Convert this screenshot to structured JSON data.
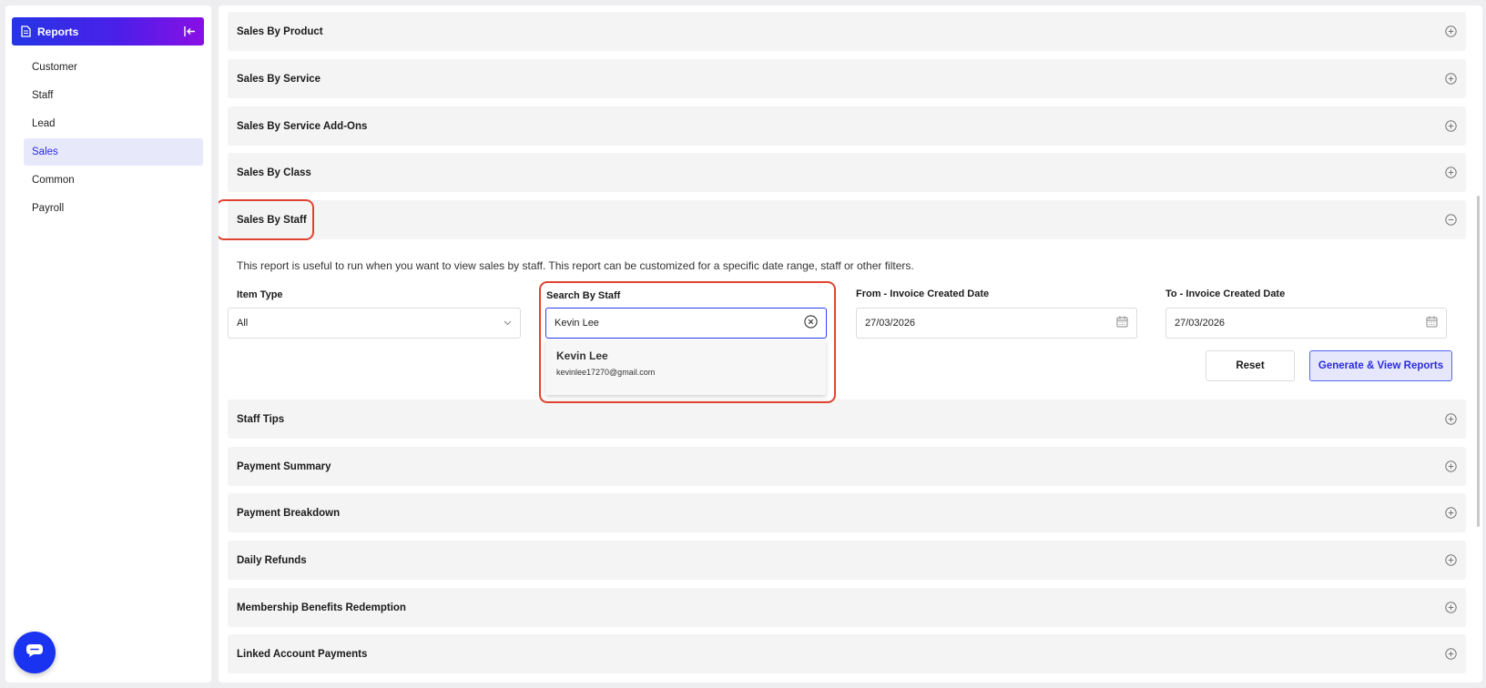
{
  "sidebar": {
    "header_title": "Reports",
    "items": [
      {
        "label": "Customer"
      },
      {
        "label": "Staff"
      },
      {
        "label": "Lead"
      },
      {
        "label": "Sales"
      },
      {
        "label": "Common"
      },
      {
        "label": "Payroll"
      }
    ],
    "active_item": "Sales"
  },
  "accordion": {
    "sales_by_product": "Sales By Product",
    "sales_by_service": "Sales By Service",
    "sales_by_service_addons": "Sales By Service Add-Ons",
    "sales_by_class": "Sales By Class",
    "sales_by_staff": "Sales By Staff",
    "staff_tips": "Staff Tips",
    "payment_summary": "Payment Summary",
    "payment_breakdown": "Payment Breakdown",
    "daily_refunds": "Daily Refunds",
    "membership_benefits": "Membership Benefits Redemption",
    "linked_account_payments": "Linked Account Payments"
  },
  "sales_by_staff_panel": {
    "description": "This report is useful to run when you want to view sales by staff. This report can be customized for a specific date range, staff or other filters.",
    "item_type": {
      "label": "Item Type",
      "value": "All"
    },
    "search_by_staff": {
      "label": "Search By Staff",
      "value": "Kevin Lee"
    },
    "from_date": {
      "label": "From - Invoice Created Date",
      "value": "27/03/2026"
    },
    "to_date": {
      "label": "To - Invoice Created Date",
      "value": "27/03/2026"
    },
    "suggestion": {
      "name": "Kevin Lee",
      "email": "kevinlee17270@gmail.com"
    },
    "reset_label": "Reset",
    "generate_label": "Generate & View Reports"
  },
  "colors": {
    "accent": "#2b3ef0",
    "highlight": "#e0442f",
    "active_bg": "#e8e8fb"
  },
  "icons": {
    "header": "document-icon",
    "collapse": "collapse-left-icon",
    "expand": "plus-circle-icon",
    "collapse_section": "minus-circle-icon",
    "clear": "clear-circle-icon",
    "calendar": "calendar-icon",
    "chat": "chat-icon"
  }
}
